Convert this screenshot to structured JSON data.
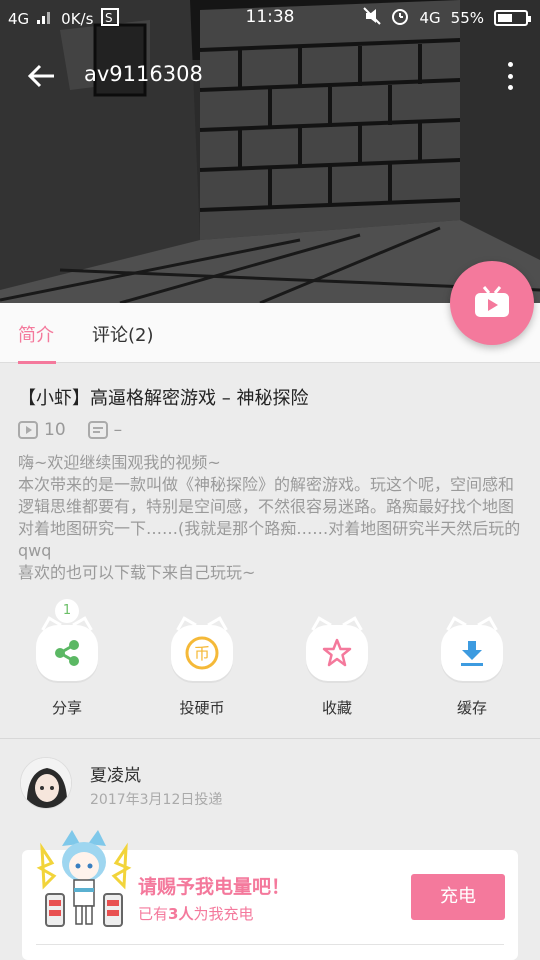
{
  "status_bar": {
    "network": "4G",
    "speed": "0K/s",
    "time": "11:38",
    "net2": "4G",
    "battery": "55%",
    "battery_level": 0.55
  },
  "toolbar": {
    "title": "av9116308"
  },
  "tabs": [
    {
      "label": "简介",
      "active": true
    },
    {
      "label": "评论(2)",
      "active": false
    }
  ],
  "video": {
    "title": "【小虾】高逼格解密游戏 – 神秘探险",
    "plays": "10",
    "danmaku": "–",
    "description": "嗨~欢迎继续围观我的视频~\n本次带来的是一款叫做《神秘探险》的解密游戏。玩这个呢，空间感和逻辑思维都要有，特别是空间感，不然很容易迷路。路痴最好找个地图对着地图研究一下……(我就是那个路痴……对着地图研究半天然后玩的qwq\n喜欢的也可以下载下来自己玩玩~"
  },
  "actions": {
    "share": {
      "label": "分享",
      "badge": "1"
    },
    "coin": {
      "label": "投硬币",
      "glyph": "币"
    },
    "favorite": {
      "label": "收藏"
    },
    "cache": {
      "label": "缓存"
    }
  },
  "uploader": {
    "name": "夏凌岚",
    "date": "2017年3月12日投递"
  },
  "charge": {
    "headline": "请赐予我电量吧！",
    "sub_prefix": "已有",
    "sub_count": "3人",
    "sub_suffix": "为我充电",
    "button": "充电"
  },
  "colors": {
    "accent": "#f4799c",
    "share_green": "#5bb864",
    "coin_yellow": "#f5b938",
    "cache_blue": "#3d9be0"
  }
}
